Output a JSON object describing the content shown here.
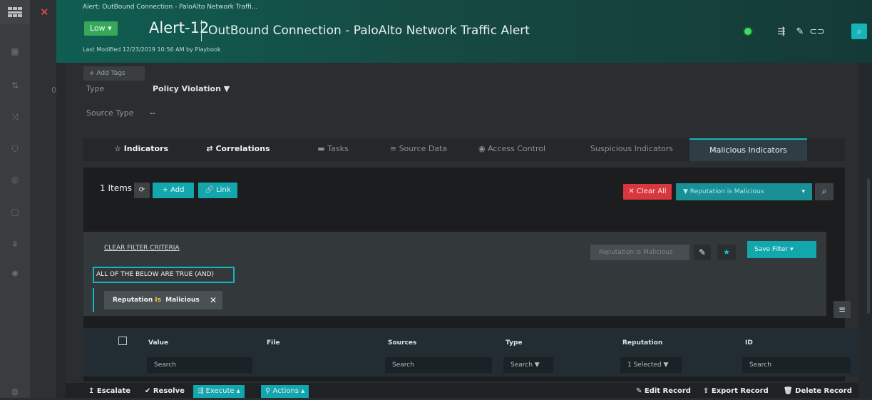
{
  "sidebar": {
    "logo_icon": "grid-logo",
    "icons": [
      "dashboard-icon",
      "queue-icon",
      "correlation-icon",
      "shield-icon",
      "compass-icon",
      "briefcase-icon",
      "chart-icon",
      "settings-icon",
      "profile-icon"
    ]
  },
  "close_mark": "✕",
  "stray_digit": "0",
  "header": {
    "breadcrumb": "Alert: OutBound Connection - PaloAlto Network Traffi...",
    "priority": "Low ▾",
    "alert_id": "Alert-12",
    "alert_title": "OutBound Connection - PaloAlto Network Traffic Alert",
    "last_modified": "Last Modified 12/23/2019 10:56 AM by Playbook",
    "status_color": "#3ddc6a"
  },
  "fields": {
    "add_tags": "+ Add Tags",
    "type_label": "Type",
    "type_value": "Policy Violation  ▼",
    "source_type_label": "Source Type",
    "source_type_value": "--"
  },
  "tabs": [
    {
      "icon": "☆",
      "label": "Indicators"
    },
    {
      "icon": "⇄",
      "label": "Correlations"
    },
    {
      "icon": "▬",
      "label": "Tasks"
    },
    {
      "icon": "≡",
      "label": "Source Data"
    },
    {
      "icon": "◉",
      "label": "Access Control"
    },
    {
      "icon": "",
      "label": "Suspicious Indicators"
    },
    {
      "icon": "",
      "label": "Malicious Indicators"
    }
  ],
  "toolbar": {
    "items_count": "1 Items",
    "refresh": "⟳",
    "add": "+ Add",
    "link": "🔗 Link",
    "clear_all": "✕ Clear All",
    "reputation_filter": "▼ Reputation is Malicious",
    "reputation_caret": "▾",
    "search": "⌕"
  },
  "filter": {
    "clear_criteria": "CLEAR FILTER CRITERIA",
    "reputation_input": "Reputation is Malicious",
    "edit": "✎",
    "star": "★",
    "save_filter": "Save Filter   ▾",
    "all_true": "ALL OF THE BELOW ARE TRUE (AND)",
    "condition": {
      "field": "Reputation",
      "op": "Is",
      "value": "Malicious",
      "remove": "✕"
    },
    "menu": "≡"
  },
  "table": {
    "columns": [
      "Value",
      "File",
      "Sources",
      "Type",
      "Reputation",
      "ID"
    ],
    "search_fields": [
      "Search",
      "",
      "Search",
      "Search ▼",
      "1 Selected ▼",
      "Search"
    ]
  },
  "bottom_bar": {
    "escalate": "↥ Escalate",
    "resolve": "✔ Resolve",
    "execute": "⇶ Execute ▴",
    "actions": "⚲ Actions ▴",
    "edit_record": "✎ Edit Record",
    "export_record": "⇪ Export Record",
    "delete_record": "🗑 Delete Record"
  }
}
